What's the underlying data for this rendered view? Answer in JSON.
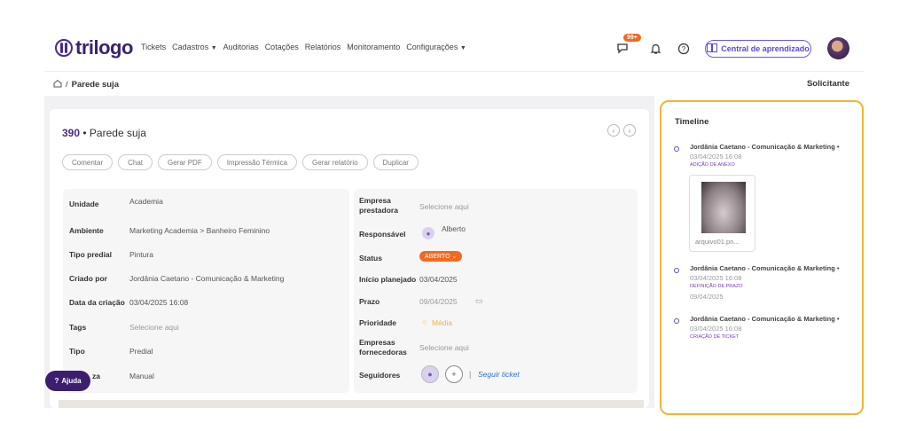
{
  "header": {
    "logo_text": "trilogo",
    "nav": [
      "Tickets",
      "Cadastros",
      "Auditorias",
      "Cotações",
      "Relatórios",
      "Monitoramento",
      "Configurações"
    ],
    "chat_badge": "99+",
    "learn_button": "Central de aprendizado"
  },
  "breadcrumb": {
    "home_sep": "/",
    "current": "Parede suja"
  },
  "role_label": "Solicitante",
  "ticket": {
    "number": "390",
    "separator": "•",
    "title": "Parede suja",
    "actions": [
      "Comentar",
      "Chat",
      "Gerar PDF",
      "Impressão Térmica",
      "Gerar relatório",
      "Duplicar"
    ]
  },
  "details_left": [
    {
      "label": "Unidade",
      "value": "Academia"
    },
    {
      "label": "Ambiente",
      "value": "Marketing Academia > Banheiro Feminino"
    },
    {
      "label": "Tipo predial",
      "value": "Pintura"
    },
    {
      "label": "Criado por",
      "value": "Jordânia Caetano - Comunicação & Marketing"
    },
    {
      "label": "Data da criação",
      "value": "03/04/2025 16:08"
    },
    {
      "label": "Tags",
      "value": "Selecione aqui"
    },
    {
      "label": "Tipo",
      "value": "Predial"
    },
    {
      "label": "za",
      "value": "Manual"
    }
  ],
  "details_right": {
    "empresa_prestadora_label": "Empresa prestadora",
    "empresa_prestadora_value": "Selecione aqui",
    "responsavel_label": "Responsável",
    "responsavel_value": "Alberto",
    "status_label": "Status",
    "status_value": "ABERTO",
    "inicio_label": "Início planejado",
    "inicio_value": "03/04/2025",
    "prazo_label": "Prazo",
    "prazo_value": "09/04/2025",
    "prioridade_label": "Prioridade",
    "prioridade_value": "Média",
    "fornecedoras_label": "Empresas fornecedoras",
    "fornecedoras_value": "Selecione aqui",
    "seguidores_label": "Seguidores",
    "seguir_label": "Seguir ticket"
  },
  "help_label": "Ajuda",
  "timeline": {
    "title": "Timeline",
    "items": [
      {
        "name": "Jordânia Caetano - Comunicação & Marketing •",
        "date": "03/04/2025 16:08",
        "type": "ADIÇÃO DE ANEXO",
        "attachment": "arquivo01.pn..."
      },
      {
        "name": "Jordânia Caetano - Comunicação & Marketing •",
        "date": "03/04/2025 16:08",
        "type": "DEFINIÇÃO DE PRAZO",
        "extra": "09/04/2025"
      },
      {
        "name": "Jordânia Caetano - Comunicação & Marketing •",
        "date": "03/04/2025 16:08",
        "type": "CRIAÇÃO DE TICKET"
      }
    ]
  },
  "colors": {
    "brand": "#3a2270",
    "accent": "#f26a21",
    "highlight": "#f2b534",
    "link": "#2f6fd0"
  }
}
